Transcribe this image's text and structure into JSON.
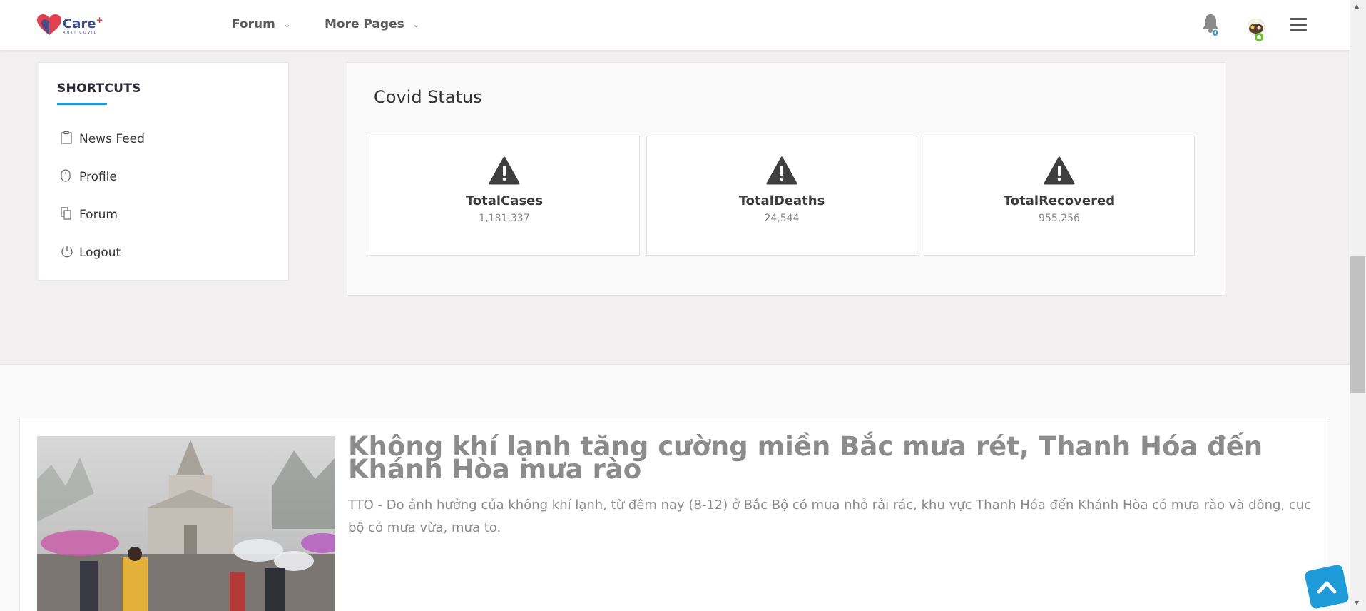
{
  "header": {
    "logo": {
      "text": "Care",
      "sup": "+",
      "sub": "ANTI COVID"
    },
    "nav": [
      {
        "label": "Forum"
      },
      {
        "label": "More Pages"
      }
    ],
    "notifications_count": "0",
    "colors": {
      "accent": "#1e9bd8",
      "online": "#6bbf2a"
    }
  },
  "sidebar": {
    "title": "SHORTCUTS",
    "items": [
      {
        "label": "News Feed",
        "icon": "clipboard-icon"
      },
      {
        "label": "Profile",
        "icon": "mouse-icon"
      },
      {
        "label": "Forum",
        "icon": "copy-icon"
      },
      {
        "label": "Logout",
        "icon": "power-icon"
      }
    ]
  },
  "covid": {
    "title": "Covid Status",
    "stats": [
      {
        "label": "TotalCases",
        "value": "1,181,337",
        "icon": "warning-icon"
      },
      {
        "label": "TotalDeaths",
        "value": "24,544",
        "icon": "warning-icon"
      },
      {
        "label": "TotalRecovered",
        "value": "955,256",
        "icon": "warning-icon"
      }
    ]
  },
  "news": {
    "title": "Không khí lạnh tăng cường miền Bắc mưa rét, Thanh Hóa đến Khánh Hòa mưa rào",
    "description": "TTO - Do ảnh hưởng của không khí lạnh, từ đêm nay (8-12) ở Bắc Bộ có mưa nhỏ rải rác, khu vực Thanh Hóa đến Khánh Hòa có mưa rào và dông, cục bộ có mưa vừa, mưa to."
  }
}
